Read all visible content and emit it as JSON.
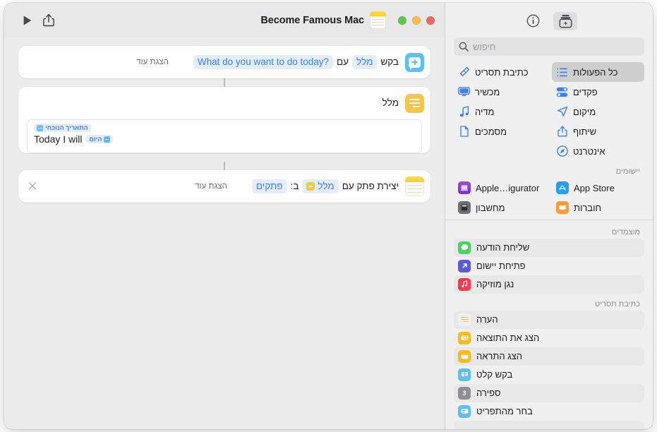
{
  "window": {
    "traffic": {
      "close": "#ec6a5f",
      "minimize": "#f4bd4f",
      "maximize": "#61c554"
    }
  },
  "toolbar": {
    "run_label": "▶",
    "share_label": "Share",
    "info_label": "Info",
    "add_action_label": "Add action",
    "workflow_title": "Become Famous Mac"
  },
  "sidebar": {
    "search": {
      "placeholder": "חיפוש",
      "value": ""
    },
    "categories": [
      {
        "label": "כל הפעולות",
        "icon": "list-icon",
        "selected": true
      },
      {
        "label": "כתיבת תסריט",
        "icon": "script-icon",
        "selected": false
      },
      {
        "label": "פקדים",
        "icon": "controls-icon",
        "selected": false
      },
      {
        "label": "מכשיר",
        "icon": "device-icon",
        "selected": false
      },
      {
        "label": "מיקום",
        "icon": "location-icon",
        "selected": false
      },
      {
        "label": "מדיה",
        "icon": "media-icon",
        "selected": false
      },
      {
        "label": "שיתוף",
        "icon": "share-icon",
        "selected": false
      },
      {
        "label": "מסמכים",
        "icon": "documents-icon",
        "selected": false
      },
      {
        "label": "אינטרנט",
        "icon": "internet-icon",
        "selected": false
      }
    ],
    "apps_header": "יישומים",
    "apps": [
      {
        "label": "App Store",
        "icon": "appstore-icon",
        "color": "#2a9bf0"
      },
      {
        "label": "Apple…igurator",
        "icon": "configurator-icon",
        "color": "#8b3fd6"
      },
      {
        "label": "חוברות",
        "icon": "books-icon",
        "color": "#ff9c33"
      },
      {
        "label": "מחשבון",
        "icon": "calculator-icon",
        "color": "#6e6e73"
      }
    ],
    "pinned_header": "מוצמדים",
    "pinned": [
      {
        "label": "שליחת הודעה",
        "icon": "messages-icon",
        "color": "#4cd263"
      },
      {
        "label": "פתיחת יישום",
        "icon": "open-app-icon",
        "color": "#5b5bd6"
      },
      {
        "label": "נגן מוזיקה",
        "icon": "music-icon",
        "color": "#fa3b4e"
      }
    ],
    "scripting_header": "כתיבת תסריט",
    "scripting": [
      {
        "label": "הערה",
        "icon": "comment-icon",
        "color": "#f2f2f2"
      },
      {
        "label": "הצג את התוצאה",
        "icon": "show-result-icon",
        "color": "#f5bc22"
      },
      {
        "label": "הצג התראה",
        "icon": "show-alert-icon",
        "color": "#f5bc22"
      },
      {
        "label": "בקש קלט",
        "icon": "ask-input-icon",
        "color": "#5fc0f0"
      },
      {
        "label": "ספירה",
        "icon": "count-icon",
        "color": "#8e8e93"
      },
      {
        "label": "בחר מהתפריט",
        "icon": "choose-menu-icon",
        "color": "#5fc0f0"
      }
    ]
  },
  "workflow": {
    "actions": [
      {
        "id": "ask-for-input",
        "icon": "ask-input-icon",
        "icon_color": "#5fc0f0",
        "segments": [
          {
            "type": "plain",
            "text": "בקש"
          },
          {
            "type": "pill",
            "text": "מלל"
          },
          {
            "type": "plain",
            "text": "עם"
          },
          {
            "type": "pill",
            "text": "What do you want to do today?",
            "ltr": true
          }
        ],
        "show_more": "הצגת עוד",
        "has_close": false
      },
      {
        "id": "text",
        "icon": "text-icon",
        "icon_color": "#f5c64b",
        "title": "מלל",
        "field": {
          "token_top": "התאריך הנוכחי",
          "token_top_icon": "calendar-icon",
          "body_text": "Today I will",
          "token_inline": "היום",
          "token_inline_icon": "ask-input-icon"
        },
        "has_close": false
      },
      {
        "id": "create-note",
        "icon": "notes-icon",
        "icon_color": "#f7d24e",
        "segments": [
          {
            "type": "plain",
            "text": "יצירת פתק עם"
          },
          {
            "type": "token",
            "text": "מלל",
            "swatch": "#f5c64b"
          },
          {
            "type": "plain",
            "text": "ב:"
          },
          {
            "type": "pill",
            "text": "פתקים"
          }
        ],
        "show_more": "הצגת עוד",
        "has_close": true
      }
    ]
  }
}
